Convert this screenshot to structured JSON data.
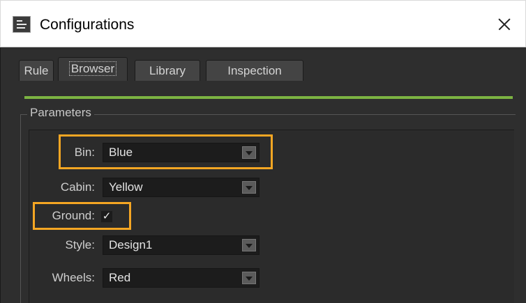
{
  "window": {
    "title": "Configurations",
    "icon": "app-settings-icon",
    "close_icon": "close-icon"
  },
  "tabs": [
    {
      "label": "Rule",
      "active": false
    },
    {
      "label": "Browser",
      "active": true
    },
    {
      "label": "Library",
      "active": false
    },
    {
      "label": "Inspection",
      "active": false
    }
  ],
  "group": {
    "title": "Parameters"
  },
  "params": {
    "bin": {
      "label": "Bin:",
      "value": "Blue"
    },
    "cabin": {
      "label": "Cabin:",
      "value": "Yellow"
    },
    "ground": {
      "label": "Ground:",
      "checked": true,
      "check_glyph": "✓"
    },
    "style": {
      "label": "Style:",
      "value": "Design1"
    },
    "wheels": {
      "label": "Wheels:",
      "value": "Red"
    }
  },
  "colors": {
    "accent_bar": "#7cb342",
    "highlight": "#f5a623",
    "background": "#2e2e2e"
  }
}
